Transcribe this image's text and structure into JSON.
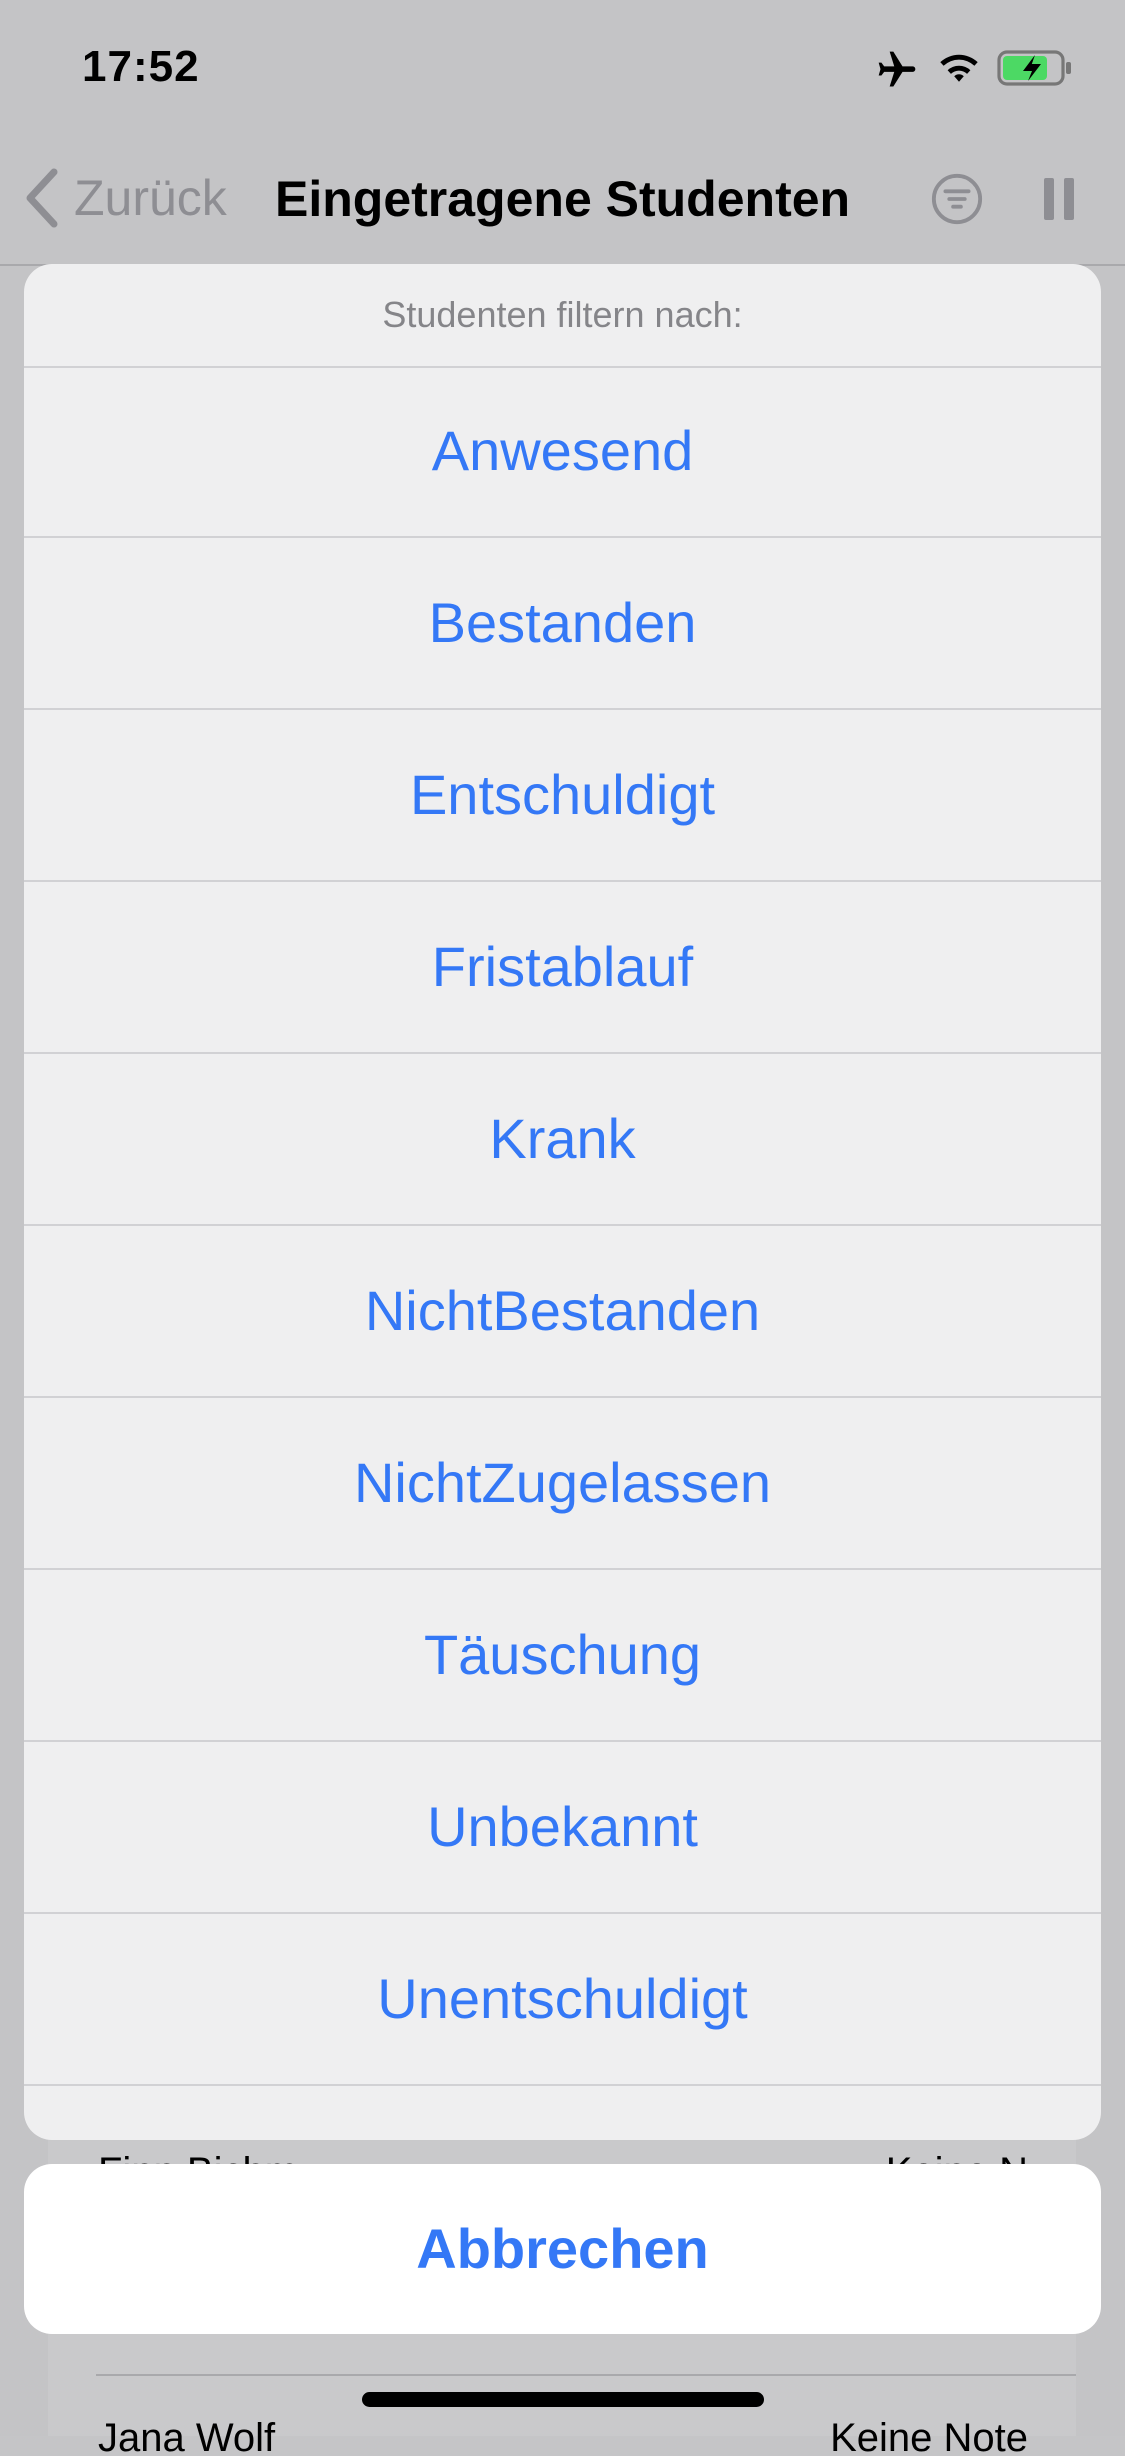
{
  "status_bar": {
    "time": "17:52",
    "icons": [
      "airplane-icon",
      "wifi-icon",
      "battery-charging-icon"
    ]
  },
  "nav": {
    "back_label": "Zurück",
    "title": "Eingetragene Studenten",
    "icons": [
      "chevron-left-icon",
      "filter-icon",
      "pause-icon"
    ]
  },
  "background_list": {
    "rows": [
      {
        "name": "Finn Bichm",
        "status": "Keine N"
      },
      {
        "name": "Jana Wolf",
        "status": "Keine Note"
      }
    ]
  },
  "action_sheet": {
    "title": "Studenten filtern nach:",
    "options": [
      "Anwesend",
      "Bestanden",
      "Entschuldigt",
      "Fristablauf",
      "Krank",
      "NichtBestanden",
      "NichtZugelassen",
      "Täuschung",
      "Unbekannt",
      "Unentschuldigt"
    ],
    "cancel_label": "Abbrechen"
  },
  "colors": {
    "accent": "#3478f6",
    "sheet_background": "#efeff0",
    "dim_background": "#c4c4c6"
  }
}
